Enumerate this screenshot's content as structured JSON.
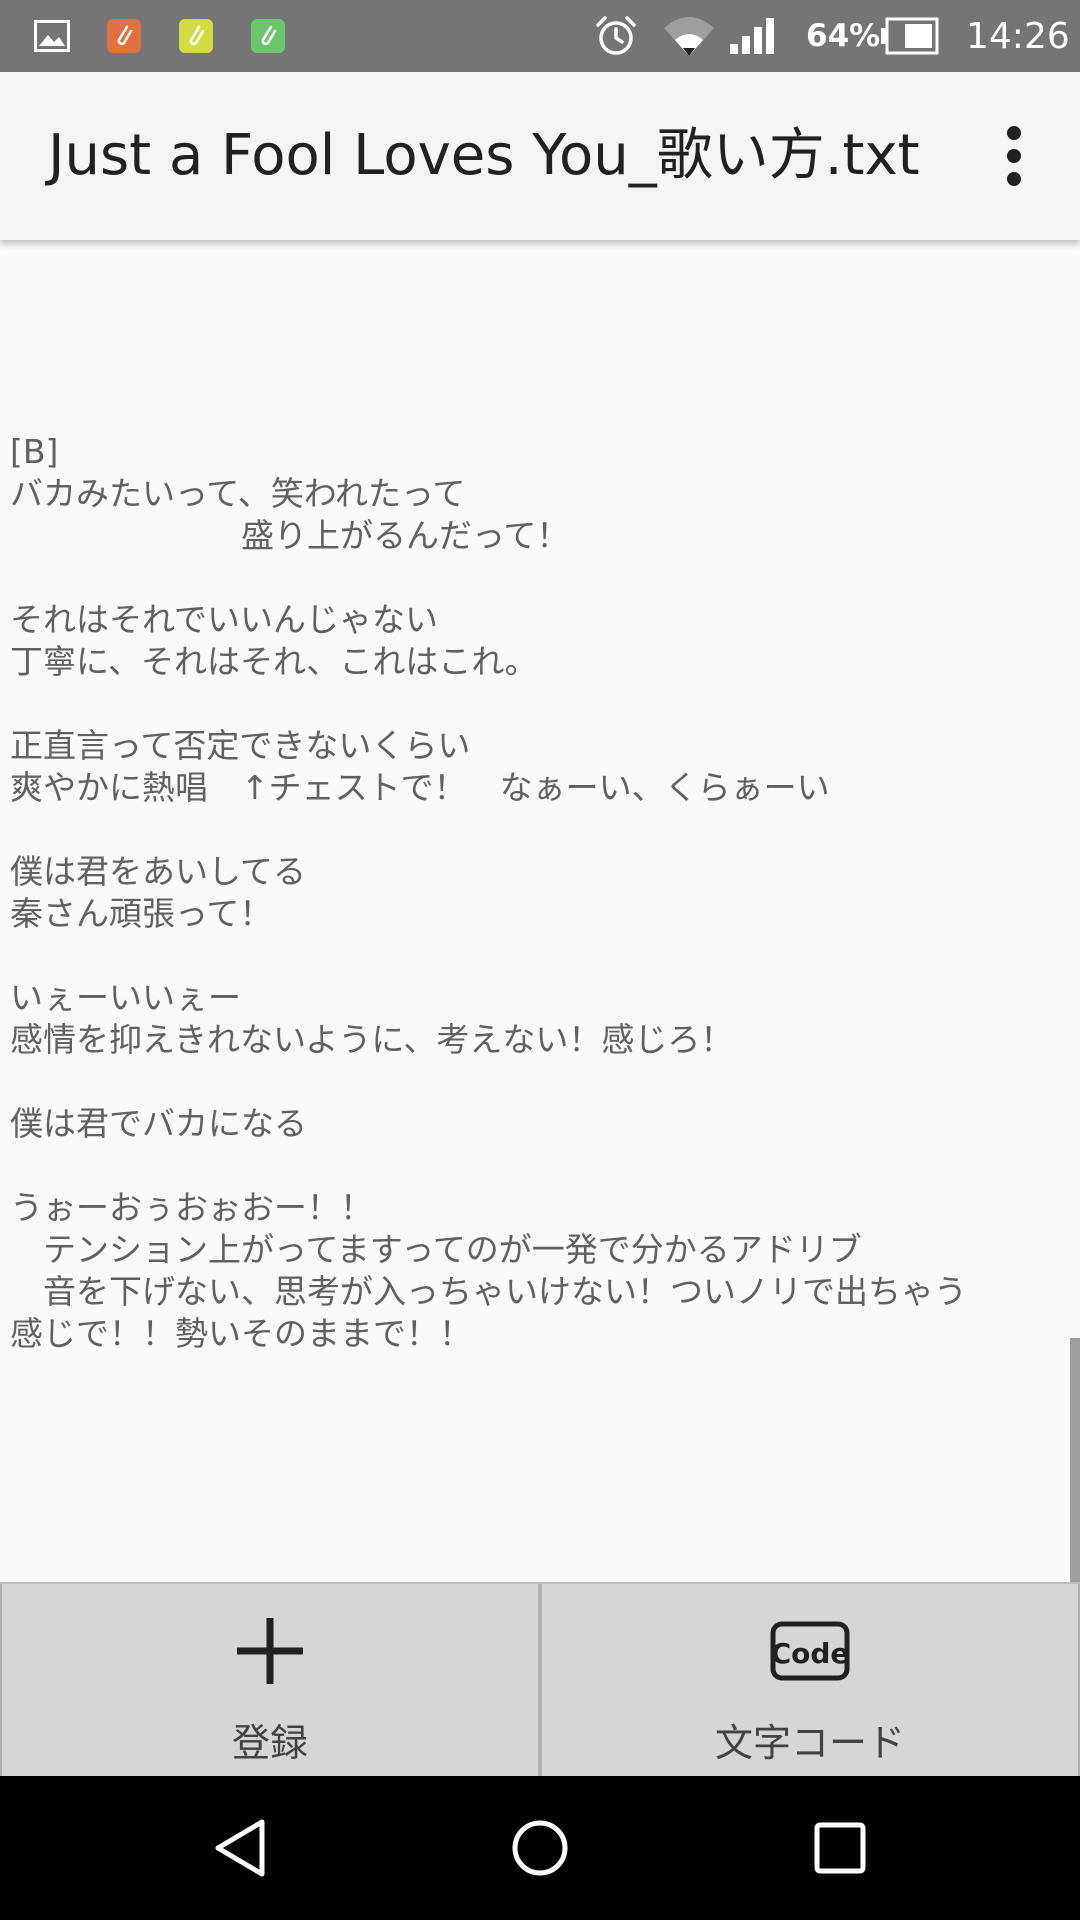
{
  "status_bar": {
    "battery_percent": "64%",
    "time": "14:26",
    "notification_icons": [
      "gallery-icon",
      "clip-orange-icon",
      "clip-yellow-icon",
      "clip-green-icon"
    ],
    "system_icons": [
      "alarm-icon",
      "wifi-icon",
      "signal-icon",
      "battery-icon"
    ]
  },
  "app_bar": {
    "title": "Just a Fool Loves You_歌い方.txt",
    "menu_icon": "overflow-menu-icon"
  },
  "content": {
    "text": "[B]\nバカみたいって、笑われたって\n　　　　　　　盛り上がるんだって！\n\nそれはそれでいいんじゃない\n丁寧に、それはそれ、これはこれ。\n\n正直言って否定できないくらい\n爽やかに熱唱　↑チェストで！　なぁーい、くらぁーい\n\n僕は君をあいしてる\n秦さん頑張って！\n\nいぇーいいぇー\n感情を抑えきれないように、考えない！感じろ！\n\n僕は君でバカになる\n\nうぉーおぅおぉおー！！\n　テンション上がってますってのが一発で分かるアドリブ\n　音を下げない、思考が入っちゃいけない！ついノリで出ちゃう\n感じで！！勢いそのままで！！"
  },
  "bottom_bar": {
    "register_label": "登録",
    "register_icon": "plus-icon",
    "encoding_label": "文字コード",
    "encoding_icon_text": "Code",
    "encoding_icon": "code-icon"
  },
  "nav_bar": {
    "icons": [
      "back-icon",
      "home-icon",
      "recents-icon"
    ]
  },
  "colors": {
    "status_bar": "#757575",
    "app_bar": "#f5f5f5",
    "text": "#616161",
    "bottom_bar": "#d6d6d6",
    "nav_bar": "#000000"
  }
}
